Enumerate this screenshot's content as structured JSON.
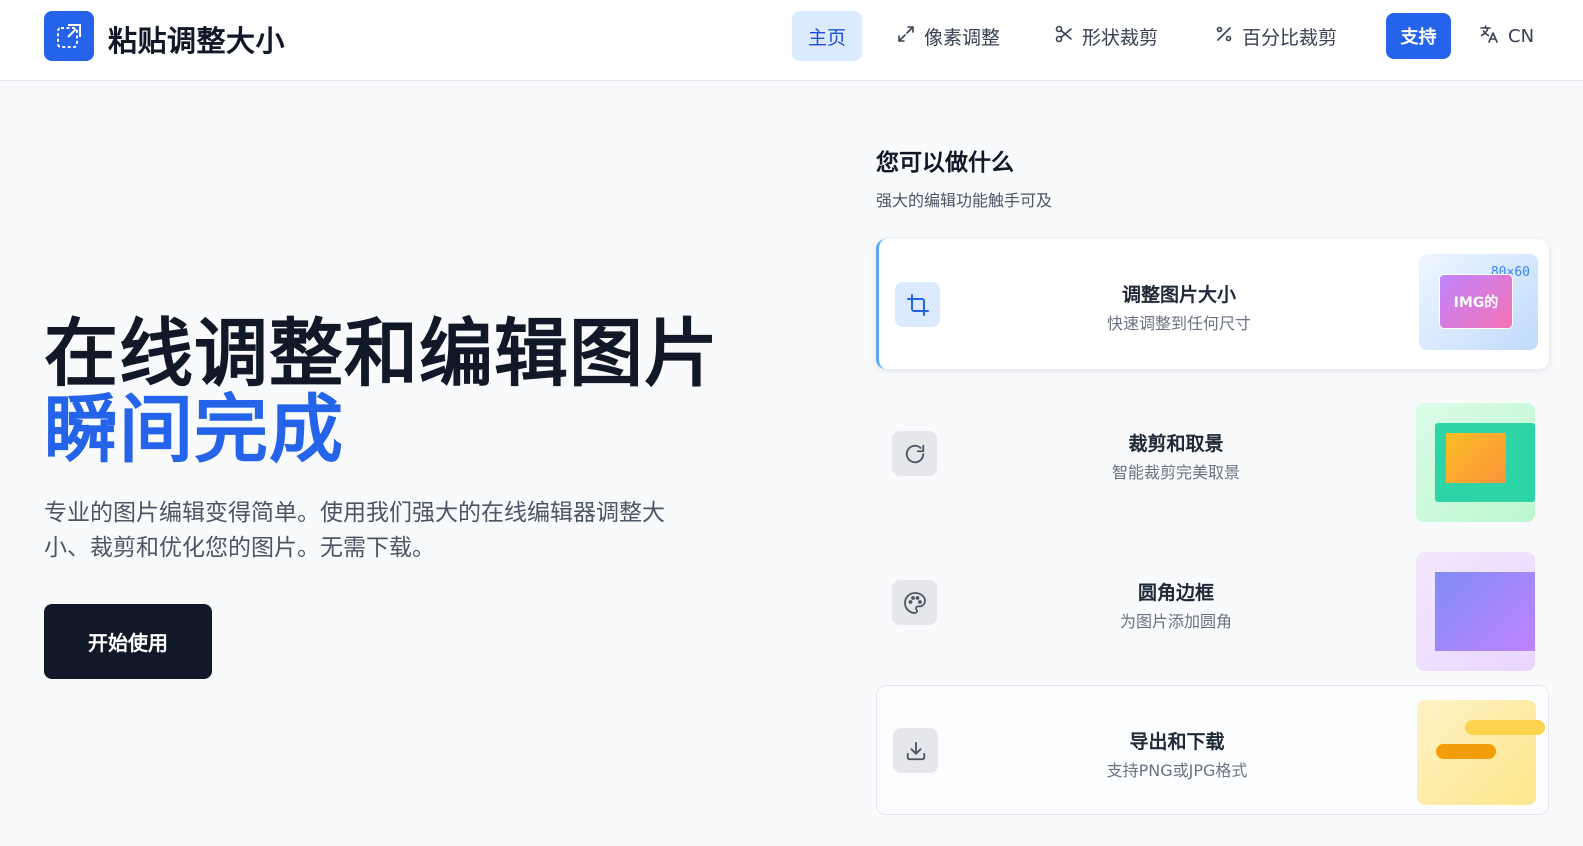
{
  "header": {
    "brand": "粘贴调整大小",
    "nav": {
      "home": "主页",
      "pixel": "像素调整",
      "shape": "形状裁剪",
      "percent": "百分比裁剪"
    },
    "support": "支持",
    "lang": "CN"
  },
  "hero": {
    "title_line1": "在线调整和编辑图片",
    "title_line2": "瞬间完成",
    "description": "专业的图片编辑变得简单。使用我们强大的在线编辑器调整大小、裁剪和优化您的图片。无需下载。",
    "cta": "开始使用"
  },
  "features": {
    "title": "您可以做什么",
    "subtitle": "强大的编辑功能触手可及",
    "items": [
      {
        "label": "调整图片大小",
        "desc": "快速调整到任何尺寸",
        "icon": "crop-icon",
        "thumb_size": "80×60",
        "thumb_tag": "IMG的"
      },
      {
        "label": "裁剪和取景",
        "desc": "智能裁剪完美取景",
        "icon": "rotate-icon"
      },
      {
        "label": "圆角边框",
        "desc": "为图片添加圆角",
        "icon": "palette-icon"
      },
      {
        "label": "导出和下载",
        "desc": "支持PNG或JPG格式",
        "icon": "download-icon"
      }
    ]
  },
  "colors": {
    "accent": "#2563eb",
    "dark": "#111827",
    "nav_active_bg": "#dbeafe"
  }
}
